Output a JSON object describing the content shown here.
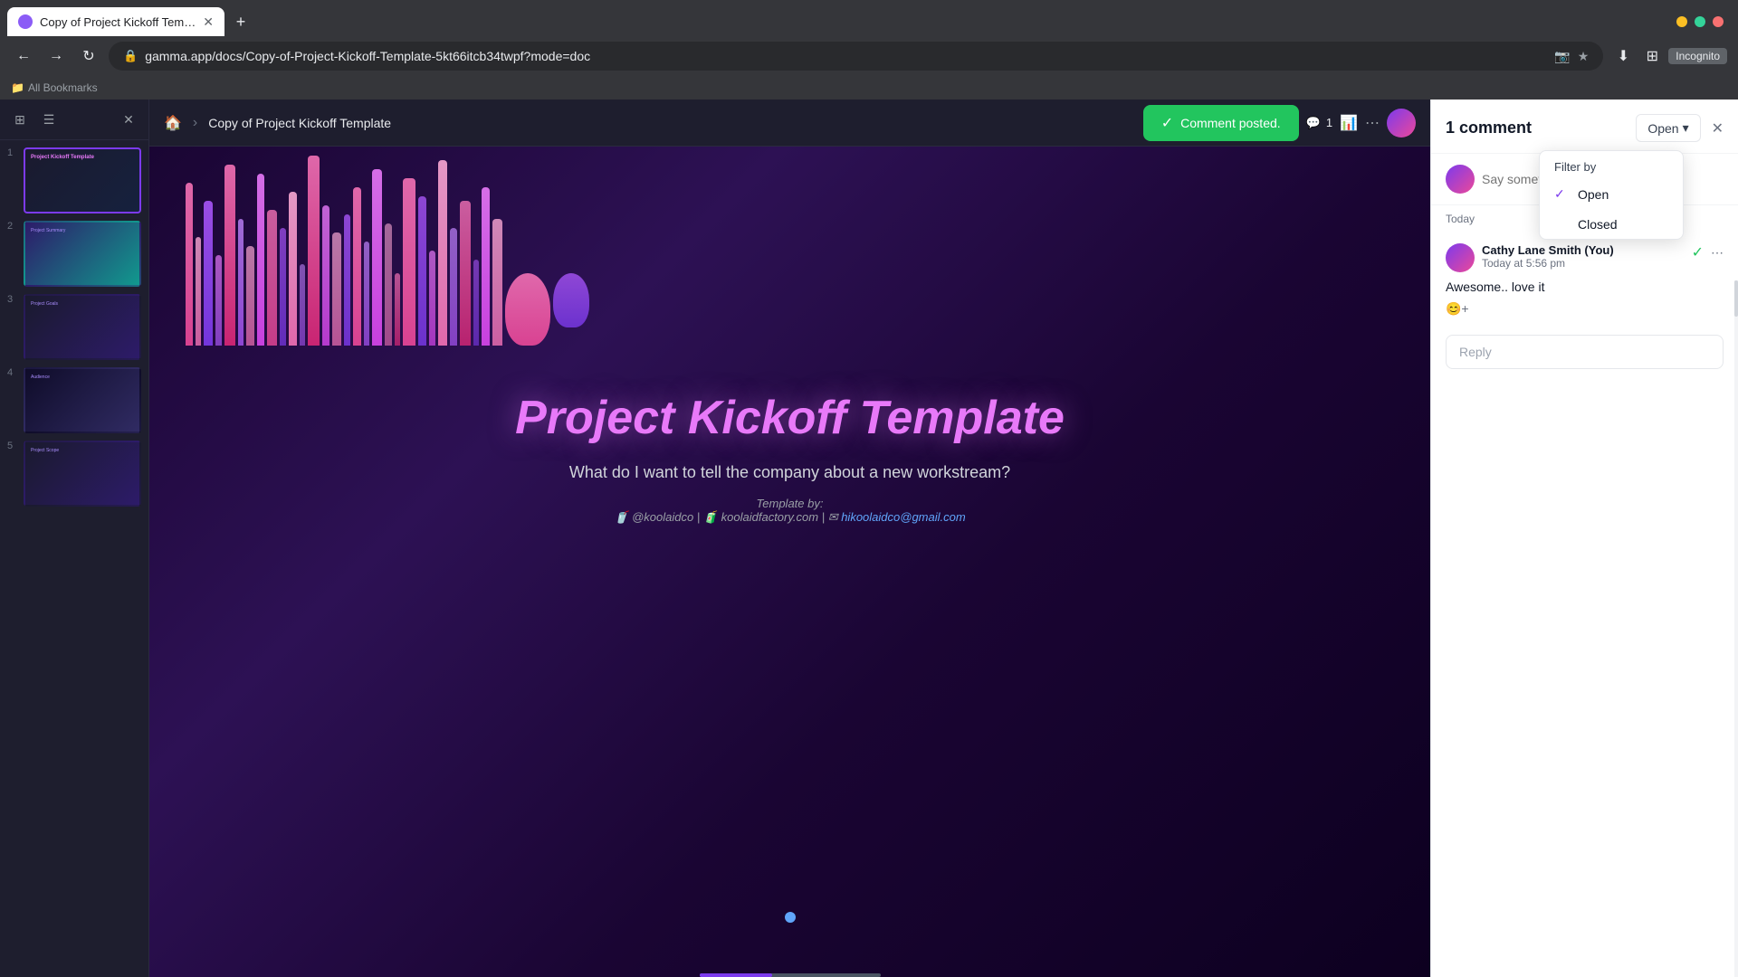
{
  "browser": {
    "tab_title": "Copy of Project Kickoff Templa...",
    "address": "gamma.app/docs/Copy-of-Project-Kickoff-Template-5kt66itcb34twpf?mode=doc",
    "incognito_label": "Incognito",
    "bookmarks_label": "All Bookmarks"
  },
  "topbar": {
    "breadcrumb_title": "Copy of Project Kickoff Template",
    "toast_message": "Comment posted.",
    "comment_count": "1"
  },
  "slide": {
    "title": "Project Kickoff Template",
    "subtitle": "What do I want to tell the company about a new workstream?",
    "template_by": "Template by:",
    "template_handle": "@koolaidco",
    "template_site": "koolaidfactory.com",
    "template_email": "hikoolaidco@gmail.com"
  },
  "panel": {
    "title": "1 comment",
    "filter_btn_label": "Open",
    "comment_placeholder": "Say something...",
    "date_label": "Today",
    "author_name": "Cathy Lane Smith (You)",
    "author_time": "Today at 5:56 pm",
    "comment_text": "Awesome.. love it",
    "reply_placeholder": "Reply"
  },
  "filter_dropdown": {
    "header": "Filter by",
    "options": [
      {
        "label": "Open",
        "checked": true
      },
      {
        "label": "Closed",
        "checked": false
      }
    ]
  },
  "slides": [
    {
      "number": "1",
      "active": true
    },
    {
      "number": "2",
      "active": false
    },
    {
      "number": "3",
      "active": false
    },
    {
      "number": "4",
      "active": false
    },
    {
      "number": "5",
      "active": false
    }
  ]
}
